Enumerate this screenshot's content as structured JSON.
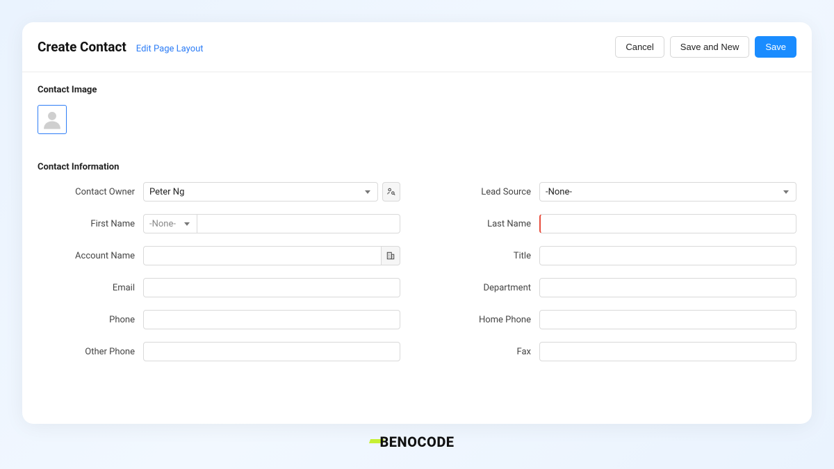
{
  "header": {
    "title": "Create Contact",
    "editLink": "Edit Page Layout",
    "cancel": "Cancel",
    "saveNew": "Save and New",
    "save": "Save"
  },
  "sections": {
    "image": "Contact Image",
    "info": "Contact Information"
  },
  "fields": {
    "contactOwner": {
      "label": "Contact Owner",
      "value": "Peter Ng"
    },
    "firstName": {
      "label": "First Name",
      "prefix": "-None-",
      "value": ""
    },
    "accountName": {
      "label": "Account Name",
      "value": ""
    },
    "email": {
      "label": "Email",
      "value": ""
    },
    "phone": {
      "label": "Phone",
      "value": ""
    },
    "otherPhone": {
      "label": "Other Phone",
      "value": ""
    },
    "leadSource": {
      "label": "Lead Source",
      "value": "-None-"
    },
    "lastName": {
      "label": "Last Name",
      "value": ""
    },
    "title": {
      "label": "Title",
      "value": ""
    },
    "department": {
      "label": "Department",
      "value": ""
    },
    "homePhone": {
      "label": "Home Phone",
      "value": ""
    },
    "fax": {
      "label": "Fax",
      "value": ""
    }
  },
  "branding": {
    "logo": "BENOCODE"
  }
}
